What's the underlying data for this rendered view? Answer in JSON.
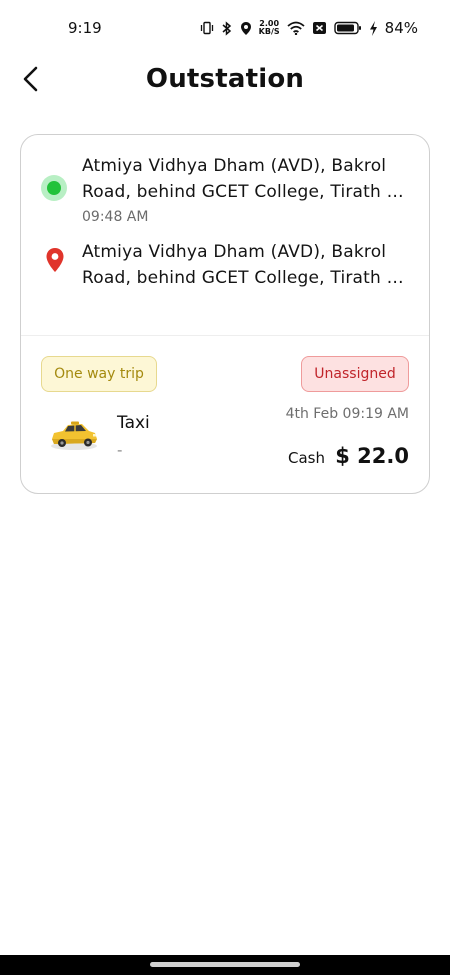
{
  "status_bar": {
    "time": "9:19",
    "net_speed_value": "2.00",
    "net_speed_unit": "KB/S",
    "battery_percent": "84%",
    "icons": [
      "vibrate-icon",
      "bluetooth-icon",
      "location-icon",
      "wifi-icon",
      "no-sim-icon",
      "battery-icon",
      "charging-icon"
    ]
  },
  "header": {
    "title": "Outstation",
    "back_icon": "chevron-left-icon"
  },
  "ride": {
    "pickup": {
      "line1": "Atmiya Vidhya Dham (AVD), Bakrol",
      "line2": "Road, behind GCET College, Tirath S...",
      "time": "09:48 AM"
    },
    "drop": {
      "line1": "Atmiya Vidhya Dham (AVD), Bakrol",
      "line2": "Road, behind GCET College, Tirath S..."
    },
    "trip_type": "One way trip",
    "status": "Unassigned",
    "vehicle_name": "Taxi",
    "vehicle_number": "-",
    "datetime": "4th Feb 09:19 AM",
    "payment_method": "Cash",
    "amount": "$ 22.0"
  },
  "colors": {
    "pickup_dot": "#22c23a",
    "drop_pin": "#e0342b",
    "trip_badge_text": "#a48a0f",
    "status_badge_text": "#c0242a"
  }
}
